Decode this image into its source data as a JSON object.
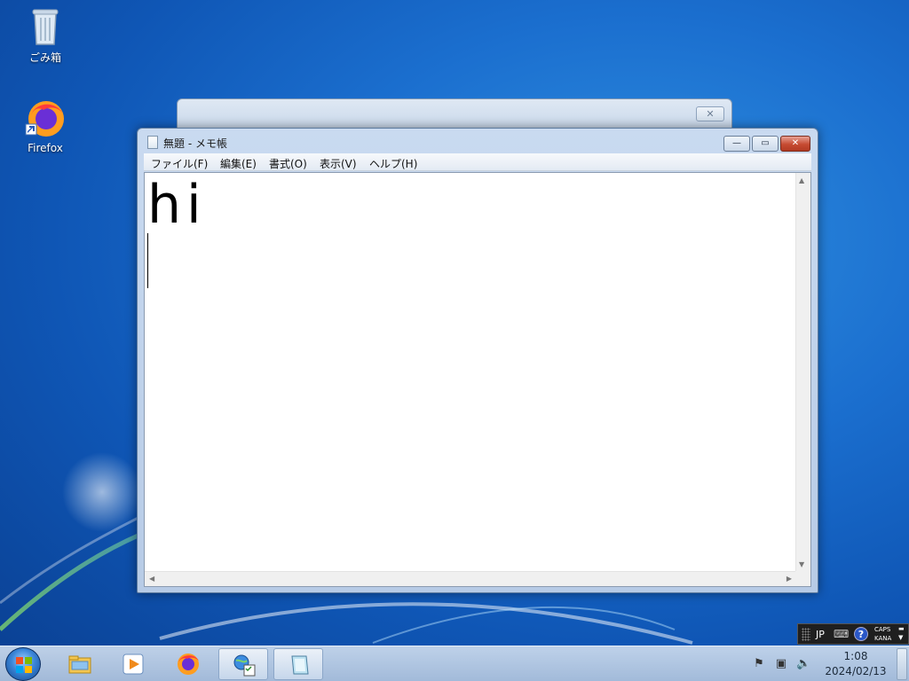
{
  "desktop": {
    "icons": [
      {
        "label": "ごみ箱",
        "icon": "recycle-bin-icon"
      },
      {
        "label": "Firefox",
        "icon": "firefox-icon"
      }
    ]
  },
  "background_window": {
    "close_glyph": "✕"
  },
  "notepad": {
    "title": "無題 - メモ帳",
    "menu": [
      "ファイル(F)",
      "編集(E)",
      "書式(O)",
      "表示(V)",
      "ヘルプ(H)"
    ],
    "content": "hi",
    "buttons": {
      "minimize": "—",
      "maximize": "▭",
      "close": "✕"
    }
  },
  "ime": {
    "mode": "JP",
    "help": "?",
    "caps": "CAPS",
    "kana": "KANA"
  },
  "taskbar": {
    "pinned": [
      "start-button",
      "explorer",
      "media-player",
      "firefox",
      "ie-control-panel",
      "notepad"
    ],
    "tray": [
      "action-center-flag-icon",
      "network-icon",
      "volume-muted-icon"
    ],
    "time": "1:08",
    "date": "2024/02/13"
  }
}
